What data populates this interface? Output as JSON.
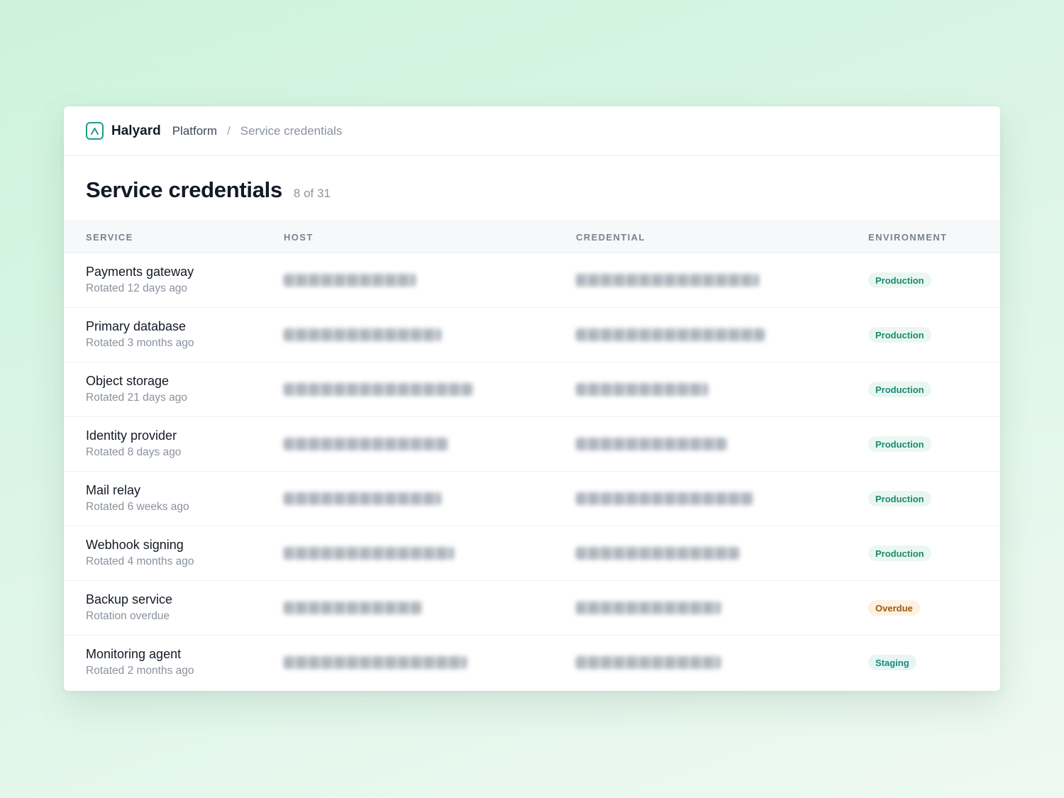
{
  "header": {
    "brand": "Halyard",
    "breadcrumb": [
      "Platform",
      "/",
      "Service credentials"
    ]
  },
  "page": {
    "title": "Service credentials",
    "count": "8 of 31"
  },
  "table": {
    "columns": [
      "SERVICE",
      "HOST",
      "CREDENTIAL",
      "ENVIRONMENT"
    ],
    "rows": [
      {
        "service": "Payments gateway",
        "status": "Rotated 12 days ago",
        "environment": "Production",
        "env_kind": "production"
      },
      {
        "service": "Primary database",
        "status": "Rotated 3 months ago",
        "environment": "Production",
        "env_kind": "production"
      },
      {
        "service": "Object storage",
        "status": "Rotated 21 days ago",
        "environment": "Production",
        "env_kind": "production"
      },
      {
        "service": "Identity provider",
        "status": "Rotated 8 days ago",
        "environment": "Production",
        "env_kind": "production"
      },
      {
        "service": "Mail relay",
        "status": "Rotated 6 weeks ago",
        "environment": "Production",
        "env_kind": "production"
      },
      {
        "service": "Webhook signing",
        "status": "Rotated 4 months ago",
        "environment": "Production",
        "env_kind": "production"
      },
      {
        "service": "Backup service",
        "status": "Rotation overdue",
        "environment": "Overdue",
        "env_kind": "overdue"
      },
      {
        "service": "Monitoring agent",
        "status": "Rotated 2 months ago",
        "environment": "Staging",
        "env_kind": "staging"
      }
    ]
  },
  "colors": {
    "accent": "#1f9d8b",
    "production_text": "#1a8a72",
    "production_bg": "#eaf7f1",
    "staging_text": "#1a8a7e",
    "staging_bg": "#e8f6f3",
    "overdue_text": "#9a5a12",
    "overdue_bg": "#fdf1e0"
  }
}
